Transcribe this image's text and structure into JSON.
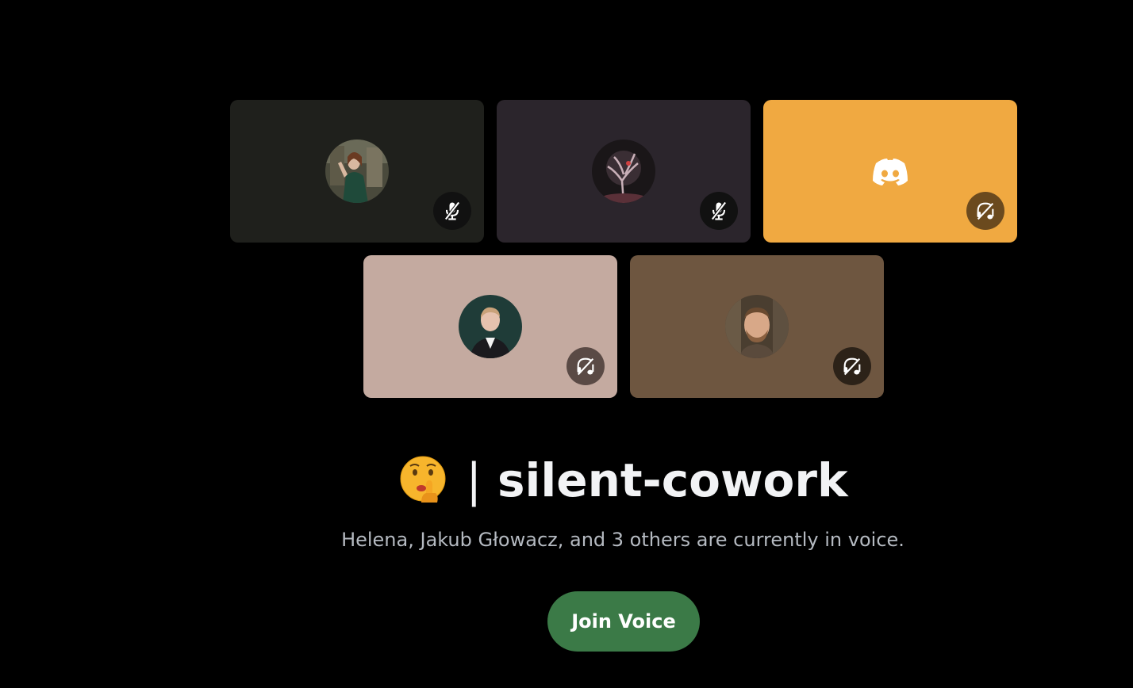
{
  "voice_tiles": [
    {
      "id": "tile-1",
      "background": "#1f201c",
      "avatar": "woman-portrait",
      "status": "mic-muted-icon",
      "status_bg": "#111111"
    },
    {
      "id": "tile-2",
      "background": "#2b252c",
      "avatar": "dark-tree-art",
      "status": "mic-muted-icon",
      "status_bg": "#111111"
    },
    {
      "id": "tile-3",
      "background": "#f0a941",
      "avatar": "discord-logo",
      "status": "headphones-deafened-icon",
      "status_bg": "#6b4a1e"
    },
    {
      "id": "tile-4",
      "background": "#c4aaa0",
      "avatar": "man-in-suit",
      "status": "headphones-deafened-icon",
      "status_bg": "#5a4a45"
    },
    {
      "id": "tile-5",
      "background": "#6e5640",
      "avatar": "bearded-man",
      "status": "headphones-deafened-icon",
      "status_bg": "#2c2218"
    }
  ],
  "channel": {
    "emoji": "shushing-face-emoji",
    "separator": "|",
    "name": "silent-cowork"
  },
  "subtitle": "Helena, Jakub Głowacz, and 3 others are currently in voice.",
  "join_button_label": "Join Voice",
  "colors": {
    "background": "#000000",
    "join_button": "#3b7a47",
    "subtitle": "#b5bac1",
    "title": "#f2f3f5"
  }
}
